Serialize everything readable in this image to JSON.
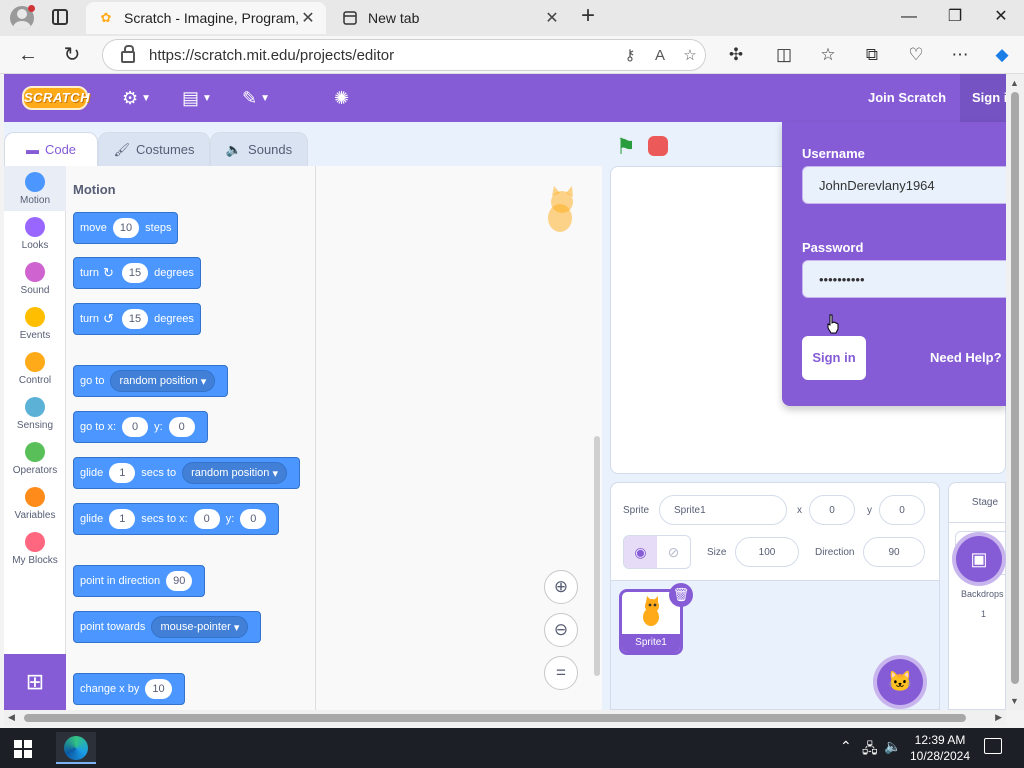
{
  "browser": {
    "tabs": [
      {
        "title": "Scratch - Imagine, Program, Share",
        "active": true
      },
      {
        "title": "New tab",
        "active": false
      }
    ],
    "url": "https://scratch.mit.edu/projects/editor"
  },
  "menubar": {
    "logo": "SCRATCH",
    "join_label": "Join Scratch",
    "signin_label": "Sign in"
  },
  "editor_tabs": [
    {
      "label": "Code"
    },
    {
      "label": "Costumes"
    },
    {
      "label": "Sounds"
    }
  ],
  "categories": [
    {
      "label": "Motion",
      "color": "#4c97ff"
    },
    {
      "label": "Looks",
      "color": "#9966ff"
    },
    {
      "label": "Sound",
      "color": "#cf63cf"
    },
    {
      "label": "Events",
      "color": "#ffbf00"
    },
    {
      "label": "Control",
      "color": "#ffab19"
    },
    {
      "label": "Sensing",
      "color": "#5cb1d6"
    },
    {
      "label": "Operators",
      "color": "#59c059"
    },
    {
      "label": "Variables",
      "color": "#ff8c1a"
    },
    {
      "label": "My Blocks",
      "color": "#ff6680"
    }
  ],
  "palette": {
    "title": "Motion",
    "blocks": {
      "move": {
        "t1": "move",
        "v1": "10",
        "t2": "steps"
      },
      "turn_right": {
        "t1": "turn",
        "v1": "15",
        "t2": "degrees"
      },
      "turn_left": {
        "t1": "turn",
        "v1": "15",
        "t2": "degrees"
      },
      "goto": {
        "t1": "go to",
        "d1": "random position"
      },
      "goto_xy": {
        "t1": "go to x:",
        "v1": "0",
        "t2": "y:",
        "v2": "0"
      },
      "glide_to": {
        "t1": "glide",
        "v1": "1",
        "t2": "secs to",
        "d1": "random position"
      },
      "glide_xy": {
        "t1": "glide",
        "v1": "1",
        "t2": "secs to x:",
        "v2": "0",
        "t3": "y:",
        "v3": "0"
      },
      "point_dir": {
        "t1": "point in direction",
        "v1": "90"
      },
      "point_towards": {
        "t1": "point towards",
        "d1": "mouse-pointer"
      },
      "change_x": {
        "t1": "change x by",
        "v1": "10"
      }
    }
  },
  "sprite_info": {
    "sprite_label": "Sprite",
    "sprite_name": "Sprite1",
    "x_label": "x",
    "x": "0",
    "y_label": "y",
    "y": "0",
    "size_label": "Size",
    "size": "100",
    "direction_label": "Direction",
    "direction": "90"
  },
  "sprites": [
    {
      "name": "Sprite1"
    }
  ],
  "stage_pane": {
    "title": "Stage",
    "backdrops_label": "Backdrops",
    "backdrops_count": "1"
  },
  "signin": {
    "username_label": "Username",
    "username_value": "JohnDerevlany1964",
    "password_label": "Password",
    "password_value": "••••••••••",
    "signin_button": "Sign in",
    "help_link": "Need Help?"
  },
  "taskbar": {
    "time": "12:39 AM",
    "date": "10/28/2024"
  },
  "colors": {
    "scratch_purple": "#855cd6",
    "motion_blue": "#4c97ff"
  }
}
